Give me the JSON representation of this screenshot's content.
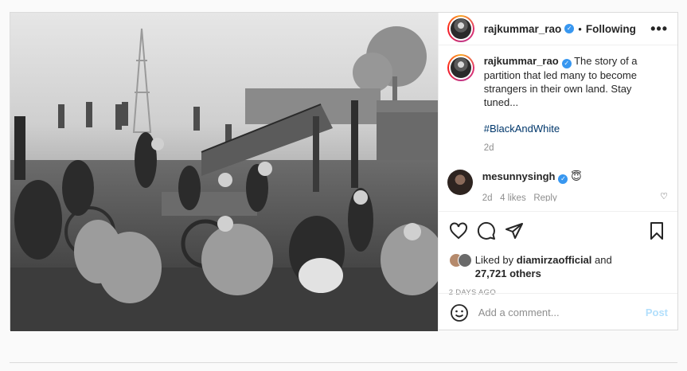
{
  "post": {
    "username": "rajkummar_rao",
    "follow_status": "Following",
    "caption": "The story of a partition that led many to become strangers in their own land. Stay tuned...",
    "hashtag": "#BlackAndWhite",
    "caption_age": "2d",
    "comment": {
      "username": "mesunnysingh",
      "text": "😇",
      "age": "2d",
      "likes": "4 likes",
      "reply": "Reply"
    },
    "liked_by_prefix": "Liked by",
    "liked_by_user": "diamirzaofficial",
    "liked_by_and": "and",
    "liked_by_others": "27,721 others",
    "date": "2 DAYS AGO",
    "comment_placeholder": "Add a comment...",
    "post_button": "Post",
    "more_icon": "•••"
  },
  "colors": {
    "verified": "#3897f0",
    "post_button": "#b2dffc",
    "hashtag": "#00376b"
  }
}
